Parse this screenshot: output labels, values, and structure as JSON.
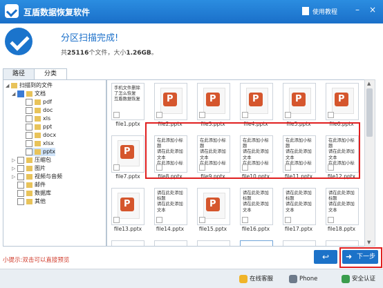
{
  "app": {
    "title": "互盾数据恢复软件",
    "tutorial": "使用教程"
  },
  "header": {
    "done": "分区扫描完成!",
    "prefix": "共",
    "count": "25116",
    "mid": "个文件，大小",
    "size": "1.26GB",
    "suffix": "。"
  },
  "tabs": [
    {
      "label": "路径"
    },
    {
      "label": "分类"
    }
  ],
  "tree": {
    "root": "扫描到的文件",
    "docs": "文档",
    "exts": [
      "pdf",
      "doc",
      "xls",
      "ppt",
      "docx",
      "xlsx",
      "pptx"
    ],
    "cats": [
      "压缩包",
      "图片",
      "视频与音频",
      "邮件",
      "数据库",
      "其他"
    ]
  },
  "files": {
    "note_text": "手机文件删除了怎么恢复\n互盾数据恢复",
    "slide_text": "在此添加小标题\n请在此处添加文本\n在此添加小标题",
    "slide_text_short": "请在此处添加标题\n请在此处添加文本",
    "row1": [
      "file1.pptx",
      "file2.pptx",
      "file3.pptx",
      "file4.pptx",
      "file5.pptx",
      "file6.pptx"
    ],
    "row2": [
      "file7.pptx",
      "file8.pptx",
      "file9.pptx",
      "file10.pptx",
      "file11.pptx",
      "file12.pptx"
    ],
    "row3": [
      "file13.pptx",
      "file14.pptx",
      "file15.pptx",
      "file16.pptx",
      "file17.pptx",
      "file18.pptx"
    ]
  },
  "hint": "小提示:双击可以直接预览",
  "buttons": {
    "back_icon": "↩",
    "next": "下一步"
  },
  "footer": {
    "service": "在线客服",
    "phone": "Phone",
    "security": "安全认证"
  },
  "colors": {
    "accent": "#1a6fc9",
    "highlight": "#e01e1e"
  }
}
